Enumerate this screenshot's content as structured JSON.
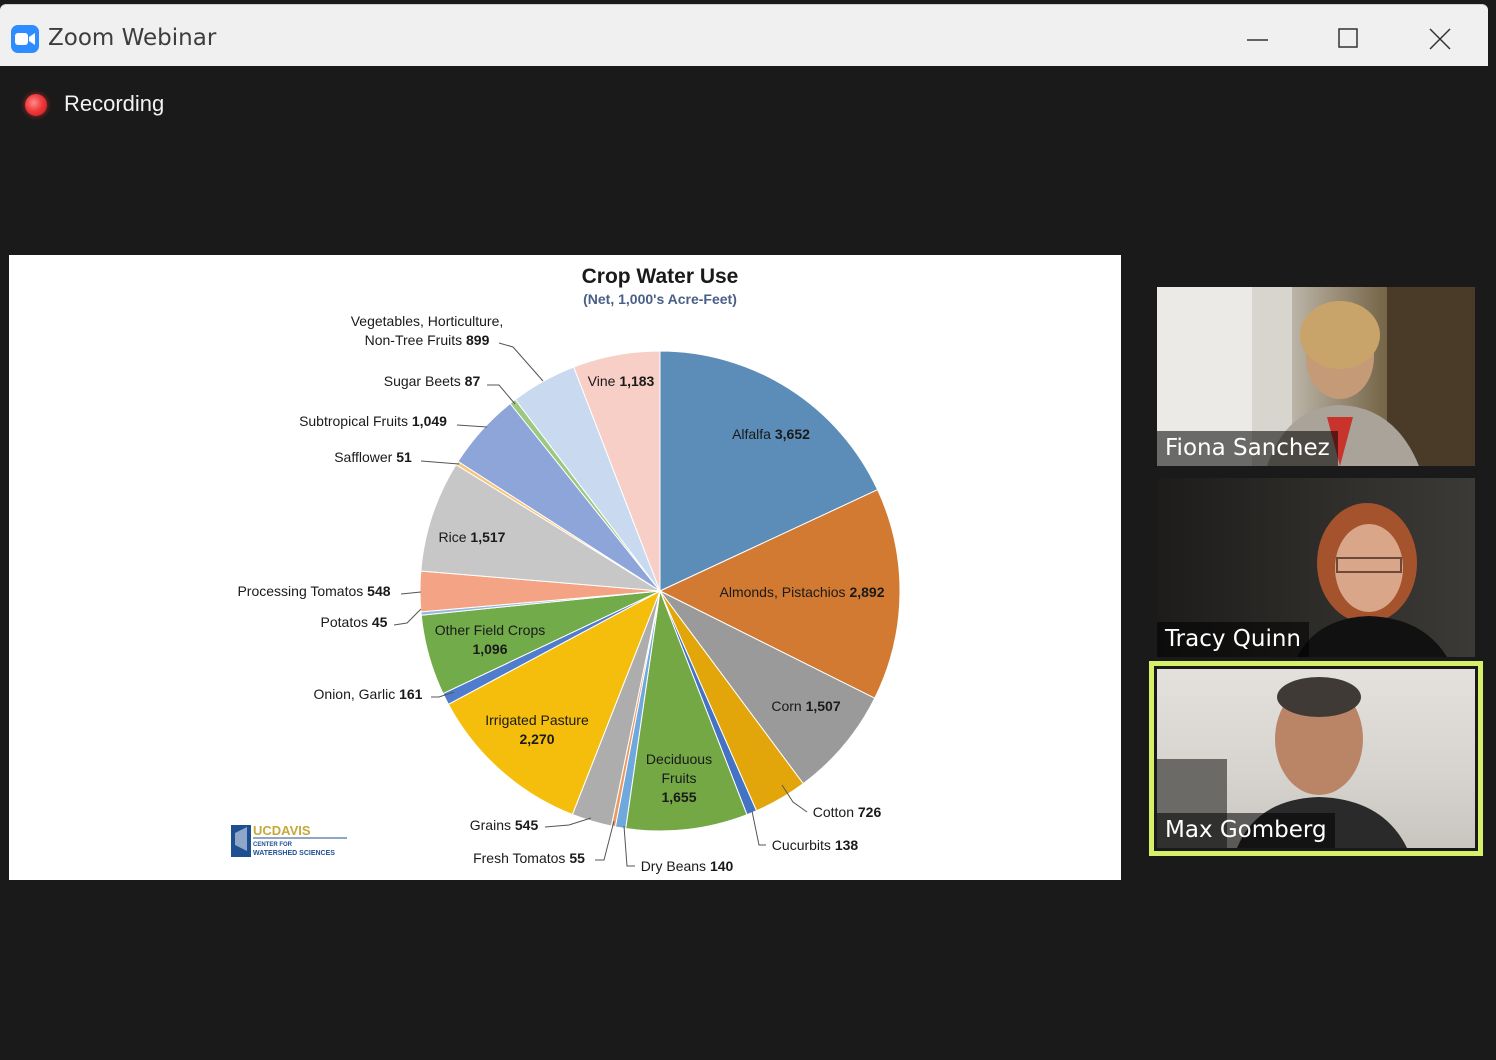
{
  "window": {
    "title": "Zoom Webinar",
    "buttons": [
      "minimize",
      "maximize",
      "close"
    ]
  },
  "recording": {
    "label": "Recording"
  },
  "slide": {
    "logo": {
      "line1": "UCDAVIS",
      "line2": "CENTER FOR",
      "line3": "WATERSHED SCIENCES"
    }
  },
  "chart_data": {
    "type": "pie",
    "title": "Crop Water Use",
    "subtitle": "(Net, 1,000's Acre-Feet)",
    "slices": [
      {
        "label": "Alfalfa",
        "value": 3652,
        "value_text": "3,652",
        "color": "#5b8db8"
      },
      {
        "label": "Almonds, Pistachios",
        "value": 2892,
        "value_text": "2,892",
        "color": "#d27a32"
      },
      {
        "label": "Corn",
        "value": 1507,
        "value_text": "1,507",
        "color": "#9a9a9a"
      },
      {
        "label": "Cotton",
        "value": 726,
        "value_text": "726",
        "color": "#e2a60b"
      },
      {
        "label": "Cucurbits",
        "value": 138,
        "value_text": "138",
        "color": "#4472c4"
      },
      {
        "label": "Deciduous Fruits",
        "value": 1655,
        "value_text": "1,655",
        "color": "#73a845"
      },
      {
        "label": "Dry Beans",
        "value": 140,
        "value_text": "140",
        "color": "#6fa8dc"
      },
      {
        "label": "Fresh Tomatos",
        "value": 55,
        "value_text": "55",
        "color": "#ec9a63"
      },
      {
        "label": "Grains",
        "value": 545,
        "value_text": "545",
        "color": "#adadad"
      },
      {
        "label": "Irrigated Pasture",
        "value": 2270,
        "value_text": "2,270",
        "color": "#f5be0c"
      },
      {
        "label": "Onion, Garlic",
        "value": 161,
        "value_text": "161",
        "color": "#4f7ccc"
      },
      {
        "label": "Other Field Crops",
        "value": 1096,
        "value_text": "1,096",
        "color": "#72ab49"
      },
      {
        "label": "Potatos",
        "value": 45,
        "value_text": "45",
        "color": "#93b9e0"
      },
      {
        "label": "Processing Tomatos",
        "value": 548,
        "value_text": "548",
        "color": "#f4a384"
      },
      {
        "label": "Rice",
        "value": 1517,
        "value_text": "1,517",
        "color": "#c7c7c7"
      },
      {
        "label": "Safflower",
        "value": 51,
        "value_text": "51",
        "color": "#f5c57c"
      },
      {
        "label": "Subtropical Fruits",
        "value": 1049,
        "value_text": "1,049",
        "color": "#8ea5da"
      },
      {
        "label": "Sugar Beets",
        "value": 87,
        "value_text": "87",
        "color": "#9bc982"
      },
      {
        "label": "Vegetables, Horticulture, Non-Tree Fruits",
        "value": 899,
        "value_text": "899",
        "color": "#c9d9ef"
      },
      {
        "label": "Vine",
        "value": 1183,
        "value_text": "1,183",
        "color": "#f7cfc6"
      }
    ]
  },
  "participants": [
    {
      "name": "Fiona Sanchez",
      "active": false
    },
    {
      "name": "Tracy Quinn",
      "active": false
    },
    {
      "name": "Max Gomberg",
      "active": true
    }
  ],
  "colors": {
    "active_speaker": "#d7f06a",
    "zoom_blue": "#2d8cff",
    "recording_red": "#f03b3b"
  }
}
